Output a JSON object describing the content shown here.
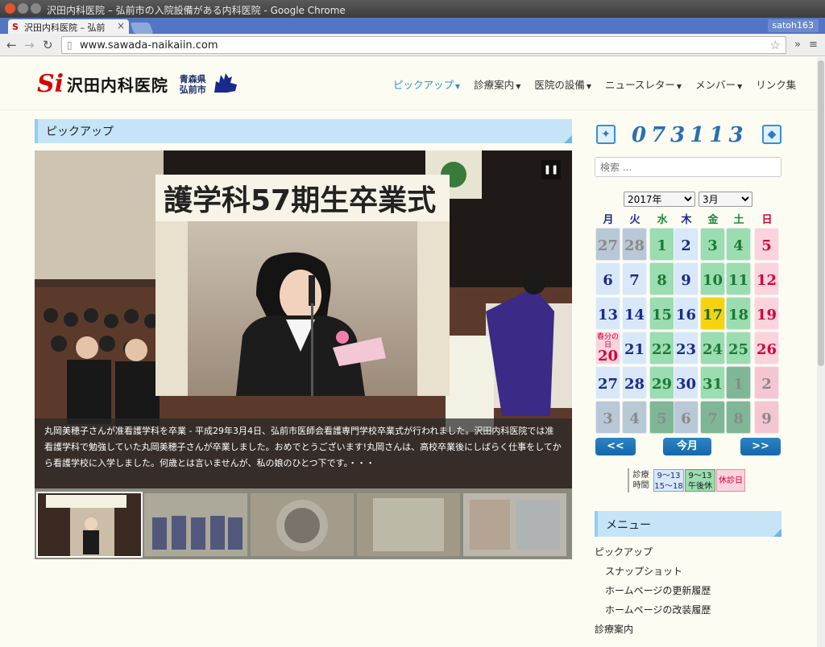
{
  "browser": {
    "window_title": "沢田内科医院 – 弘前市の入院設備がある内科医院 - Google Chrome",
    "tab_title": "沢田内科医院 – 弘前",
    "user": "satoh163",
    "url": "www.sawada-naikaiin.com"
  },
  "header": {
    "logo_mark": "Si",
    "logo_name": "沢田内科医院",
    "region_line1": "青森県",
    "region_line2": "弘前市"
  },
  "nav": [
    {
      "label": "ピックアップ",
      "dropdown": true,
      "active": true
    },
    {
      "label": "診療案内",
      "dropdown": true
    },
    {
      "label": "医院の設備",
      "dropdown": true
    },
    {
      "label": "ニュースレター",
      "dropdown": true
    },
    {
      "label": "メンバー",
      "dropdown": true
    },
    {
      "label": "リンク集",
      "dropdown": false
    }
  ],
  "pickup": {
    "heading": "ピックアップ",
    "banner_text": "護学科57期生卒業式",
    "caption": "丸岡美穂子さんが准看護学科を卒業 - 平成29年3月4日、弘前市医師会看護専門学校卒業式が行われました。沢田内科医院では准看護学科で勉強していた丸岡美穂子さんが卒業しました。おめでとうございます!丸岡さんは、高校卒業後にしばらく仕事をしてから看護学校に入学しました。何歳とは言いませんが、私の娘のひとつ下です。・・・"
  },
  "sidebar": {
    "counter": "073113",
    "search_placeholder": "検索 ...",
    "calendar": {
      "year": "2017年",
      "month": "3月",
      "weekdays": [
        "月",
        "火",
        "水",
        "木",
        "金",
        "土",
        "日"
      ],
      "weeks": [
        [
          "27",
          "28",
          "1",
          "2",
          "3",
          "4",
          "5"
        ],
        [
          "6",
          "7",
          "8",
          "9",
          "10",
          "11",
          "12"
        ],
        [
          "13",
          "14",
          "15",
          "16",
          "17",
          "18",
          "19"
        ],
        [
          "20",
          "21",
          "22",
          "23",
          "24",
          "25",
          "26"
        ],
        [
          "27",
          "28",
          "29",
          "30",
          "31",
          "1",
          "2"
        ],
        [
          "3",
          "4",
          "5",
          "6",
          "7",
          "8",
          "9"
        ]
      ],
      "holiday_label": "春分の日",
      "prev": "<<",
      "today": "今月",
      "next": ">>",
      "today_date": "17"
    },
    "legend": {
      "title_line1": "診療",
      "title_line2": "時間",
      "full_line1": "9～13",
      "full_line2": "15～18",
      "half_line1": "9～13",
      "half_line2": "午後休",
      "closed": "休診日"
    },
    "menu": {
      "heading": "メニュー",
      "items": [
        {
          "label": "ピックアップ",
          "level": 0
        },
        {
          "label": "スナップショット",
          "level": 1
        },
        {
          "label": "ホームページの更新履歴",
          "level": 1
        },
        {
          "label": "ホームページの改装履歴",
          "level": 1
        },
        {
          "label": "診療案内",
          "level": 0
        }
      ]
    }
  },
  "colors": {
    "accent": "#2f8fd0",
    "weekday_cell": "#d8e8f8",
    "halfday_cell": "#9bdcb0",
    "holiday_cell": "#fbd3dd",
    "today_cell": "#f6d311"
  }
}
